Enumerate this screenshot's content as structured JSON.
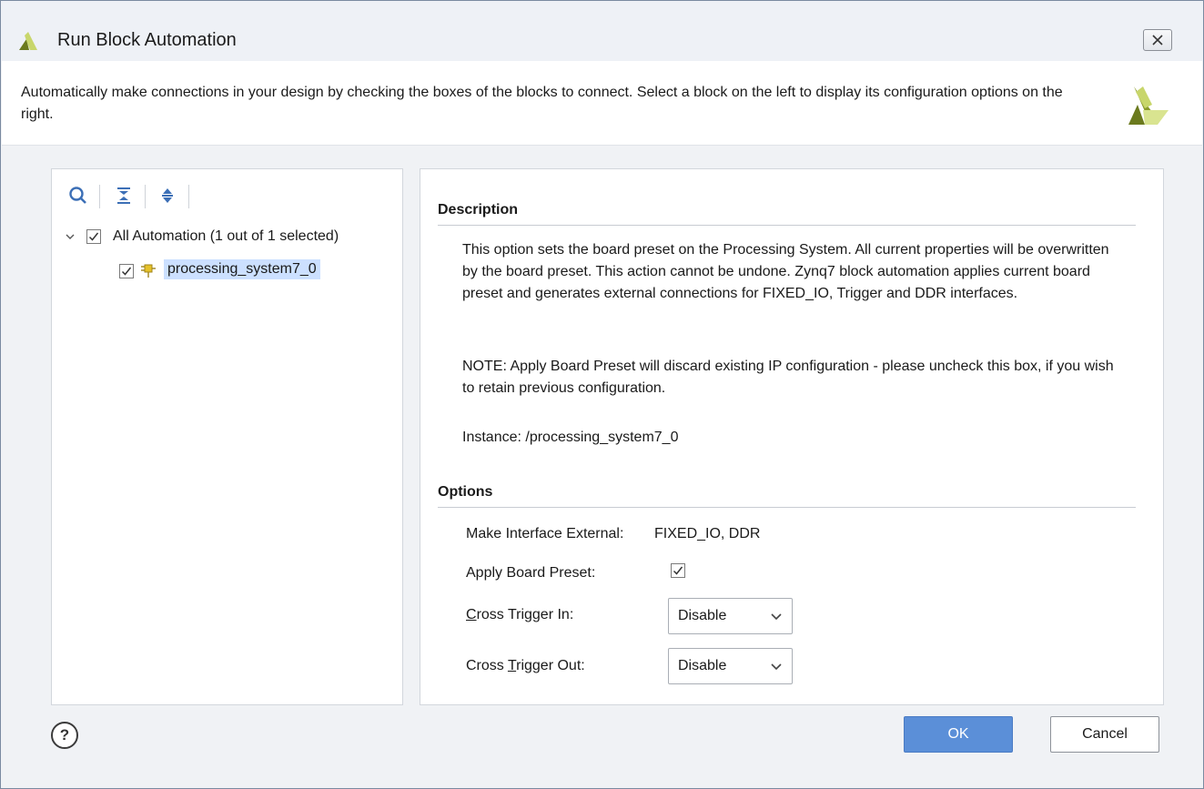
{
  "window": {
    "title": "Run Block Automation",
    "close_icon": "close-icon"
  },
  "banner": {
    "text": "Automatically make connections in your design by checking the boxes of the blocks to connect. Select a block on the left to display its configuration options on the right."
  },
  "toolbar": {
    "icons": [
      "search-icon",
      "collapse-all-icon",
      "expand-all-icon"
    ]
  },
  "tree": {
    "root_label": "All Automation (1 out of 1 selected)",
    "root_checked": true,
    "child_label": "processing_system7_0",
    "child_checked": true,
    "child_icon": "ip-block-icon"
  },
  "description": {
    "heading": "Description",
    "paragraph1": "This option sets the board preset on the Processing System. All current properties will be overwritten by the board preset. This action cannot be undone. Zynq7 block automation applies current board preset and generates external connections for FIXED_IO, Trigger and DDR interfaces.",
    "paragraph2": "NOTE: Apply Board Preset will discard existing IP configuration - please uncheck this box, if you wish to retain previous configuration.",
    "instance": "Instance: /processing_system7_0"
  },
  "options": {
    "heading": "Options",
    "make_external_label": "Make Interface External:",
    "make_external_value": "FIXED_IO, DDR",
    "apply_preset_label": "Apply Board Preset:",
    "apply_preset_checked": true,
    "cross_in_label_first": "C",
    "cross_in_label_rest": "ross Trigger In:",
    "cross_in_value": "Disable",
    "cross_out_label_pre": "Cross ",
    "cross_out_label_u": "T",
    "cross_out_label_post": "rigger Out:",
    "cross_out_value": "Disable"
  },
  "footer": {
    "help_label": "?",
    "ok_label": "OK",
    "cancel_label": "Cancel"
  },
  "colors": {
    "ok_button": "#5b8fd8",
    "selection": "#cce0ff",
    "logo_dark": "#6b7a1e",
    "logo_light": "#c8d66b"
  }
}
